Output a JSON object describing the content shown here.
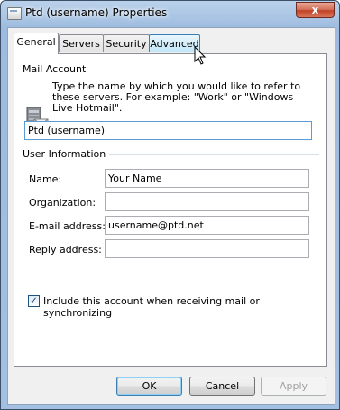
{
  "window": {
    "title": "Ptd (username) Properties",
    "close_glyph": "x"
  },
  "tabs": [
    {
      "label": "General",
      "active": true
    },
    {
      "label": "Servers",
      "active": false
    },
    {
      "label": "Security",
      "active": false
    },
    {
      "label": "Advanced",
      "active": false
    }
  ],
  "mail_account": {
    "group_title": "Mail Account",
    "description": "Type the name by which you would like to refer to these servers.  For example: \"Work\" or \"Windows Live Hotmail\".",
    "account_name": "Ptd (username)"
  },
  "user_information": {
    "group_title": "User Information",
    "fields": [
      {
        "label": "Name:",
        "value": "Your Name"
      },
      {
        "label": "Organization:",
        "value": ""
      },
      {
        "label": "E-mail address:",
        "value": "username@ptd.net"
      },
      {
        "label": "Reply address:",
        "value": ""
      }
    ]
  },
  "include_checkbox": {
    "label": "Include this account when receiving mail or synchronizing",
    "checked": true,
    "check_glyph": "✓"
  },
  "buttons": {
    "ok": "OK",
    "cancel": "Cancel",
    "apply": "Apply"
  },
  "icons": {
    "window_icon": "window-icon",
    "account_icon": "mail-server-icon",
    "cursor": "mouse-pointer-icon"
  },
  "colors": {
    "title_gradient": "#a7c3e3",
    "close_button": "#c14325",
    "focus_border": "#5b9bd5"
  }
}
